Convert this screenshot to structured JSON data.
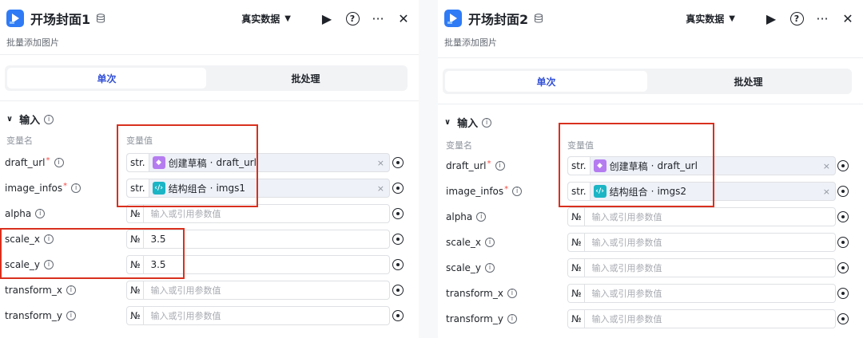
{
  "panels": [
    {
      "title": "开场封面1",
      "description": "批量添加图片",
      "mode_label": "真实数据",
      "tabs": [
        "单次",
        "批处理"
      ],
      "section_title": "输入",
      "col_name": "变量名",
      "col_value": "变量值",
      "rows": {
        "draft_url": {
          "name": "draft_url",
          "type": "str.",
          "source": "创建草稿",
          "field": "draft_url"
        },
        "image_infos": {
          "name": "image_infos",
          "type": "str.",
          "source": "结构组合",
          "field": "imgs1"
        },
        "alpha": {
          "name": "alpha",
          "type": "№",
          "placeholder": "输入或引用参数值"
        },
        "scale_x": {
          "name": "scale_x",
          "type": "№",
          "value": "3.5"
        },
        "scale_y": {
          "name": "scale_y",
          "type": "№",
          "value": "3.5"
        },
        "transform_x": {
          "name": "transform_x",
          "type": "№",
          "placeholder": "输入或引用参数值"
        },
        "transform_y": {
          "name": "transform_y",
          "type": "№",
          "placeholder": "输入或引用参数值"
        }
      }
    },
    {
      "title": "开场封面2",
      "description": "批量添加图片",
      "mode_label": "真实数据",
      "tabs": [
        "单次",
        "批处理"
      ],
      "section_title": "输入",
      "col_name": "变量名",
      "col_value": "变量值",
      "rows": {
        "draft_url": {
          "name": "draft_url",
          "type": "str.",
          "source": "创建草稿",
          "field": "draft_url"
        },
        "image_infos": {
          "name": "image_infos",
          "type": "str.",
          "source": "结构组合",
          "field": "imgs2"
        },
        "alpha": {
          "name": "alpha",
          "type": "№",
          "placeholder": "输入或引用参数值"
        },
        "scale_x": {
          "name": "scale_x",
          "type": "№",
          "placeholder": "输入或引用参数值"
        },
        "scale_y": {
          "name": "scale_y",
          "type": "№",
          "placeholder": "输入或引用参数值"
        },
        "transform_x": {
          "name": "transform_x",
          "type": "№",
          "placeholder": "输入或引用参数值"
        },
        "transform_y": {
          "name": "transform_y",
          "type": "№",
          "placeholder": "输入或引用参数值"
        }
      }
    }
  ],
  "symbols": {
    "separator": "·",
    "clear": "×",
    "caret": "▼",
    "play": "▶",
    "help": "?",
    "more": "···",
    "close": "✕",
    "collapse": "∨",
    "info": "i"
  },
  "colors": {
    "accent": "#3250d6",
    "highlight_box": "#d9301e",
    "app_icon": "#2f7bf6",
    "node_purple": "#b57cf0",
    "node_teal": "#1bb5c5"
  }
}
